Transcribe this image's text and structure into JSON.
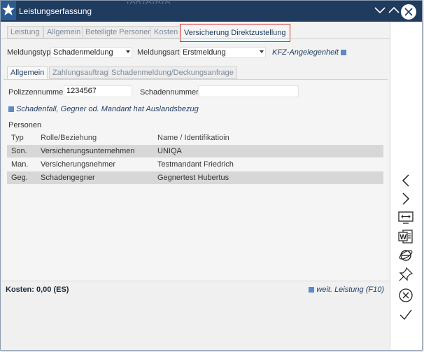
{
  "window": {
    "title": "Leistungserfassung",
    "title_ghost": "TARTATATA"
  },
  "tabs_top": [
    {
      "label": "Leistung"
    },
    {
      "label": "Allgemein"
    },
    {
      "label": "Beteiligte Personen"
    },
    {
      "label": "Kosten"
    },
    {
      "label": "Versicherung Direktzustellung",
      "active": true
    }
  ],
  "form": {
    "meldungstyp_label": "Meldungstyp",
    "meldungstyp_value": "Schadenmeldung",
    "meldungsart_label": "Meldungsart",
    "meldungsart_value": "Erstmeldung",
    "kfz_link": "KFZ-Angelegenheit"
  },
  "tabs_inner": [
    {
      "label": "Allgemein",
      "active": true
    },
    {
      "label": "Zahlungsauftrag"
    },
    {
      "label": "Schadenmeldung/Deckungsanfrage"
    }
  ],
  "allgemein": {
    "polizzennummer_label": "Polizzennummer",
    "polizzennummer_value": "1234567",
    "schadennummer_label": "Schadennummer",
    "schadennummer_value": "",
    "auslandsbezug_text": "Schadenfall, Gegner od. Mandant hat Auslandsbezug"
  },
  "personen": {
    "section_label": "Personen",
    "columns": [
      "Typ",
      "Rolle/Beziehung",
      "Name / Identifikatioin"
    ],
    "rows": [
      {
        "typ": "Son.",
        "rolle": "Versicherungsunternehmen",
        "name": "UNIQA"
      },
      {
        "typ": "Man.",
        "rolle": "Versicherungsnehmer",
        "name": "Testmandant Friedrich"
      },
      {
        "typ": "Geg.",
        "rolle": "Schadengegner",
        "name": "Gegnertest Hubertus"
      }
    ]
  },
  "footer": {
    "kosten": "Kosten: 0,00 (ES)",
    "weit_leistung": "weit. Leistung (F10)"
  },
  "colors": {
    "titlebar": "#1f3c5f",
    "active_tab_border": "#d32f2f",
    "accent_square": "#5b8ac6"
  },
  "icons": [
    "star-icon",
    "chevron-down-icon",
    "chevron-up-icon",
    "close-icon",
    "chevron-left-icon",
    "chevron-right-icon",
    "screen-resize-icon",
    "word-icon",
    "ie-icon",
    "pin-icon",
    "cancel-icon",
    "check-icon"
  ]
}
